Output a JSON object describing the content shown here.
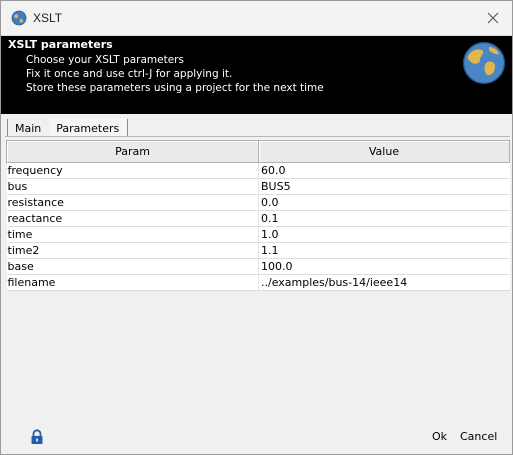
{
  "window": {
    "title": "XSLT"
  },
  "banner": {
    "title": "XSLT parameters",
    "lines": [
      "Choose your XSLT parameters",
      "Fix it once and use ctrl-J for applying it.",
      "Store these parameters using a project for the next time"
    ],
    "icon": "globe-icon"
  },
  "tabs": [
    {
      "label": "Main"
    },
    {
      "label": "Parameters"
    }
  ],
  "table": {
    "columns": [
      "Param",
      "Value"
    ],
    "rows": [
      {
        "param": "frequency",
        "value": "60.0"
      },
      {
        "param": "bus",
        "value": "BUS5"
      },
      {
        "param": "resistance",
        "value": "0.0"
      },
      {
        "param": "reactance",
        "value": "0.1"
      },
      {
        "param": "time",
        "value": "1.0"
      },
      {
        "param": "time2",
        "value": "1.1"
      },
      {
        "param": "base",
        "value": "100.0"
      },
      {
        "param": "filename",
        "value": "../examples/bus-14/ieee14"
      }
    ]
  },
  "footer": {
    "ok_label": "Ok",
    "cancel_label": "Cancel",
    "lock_icon": "lock-icon"
  },
  "colors": {
    "banner_bg": "#000000",
    "window_bg": "#f0f0f0",
    "lock_blue": "#1f5fa8"
  }
}
